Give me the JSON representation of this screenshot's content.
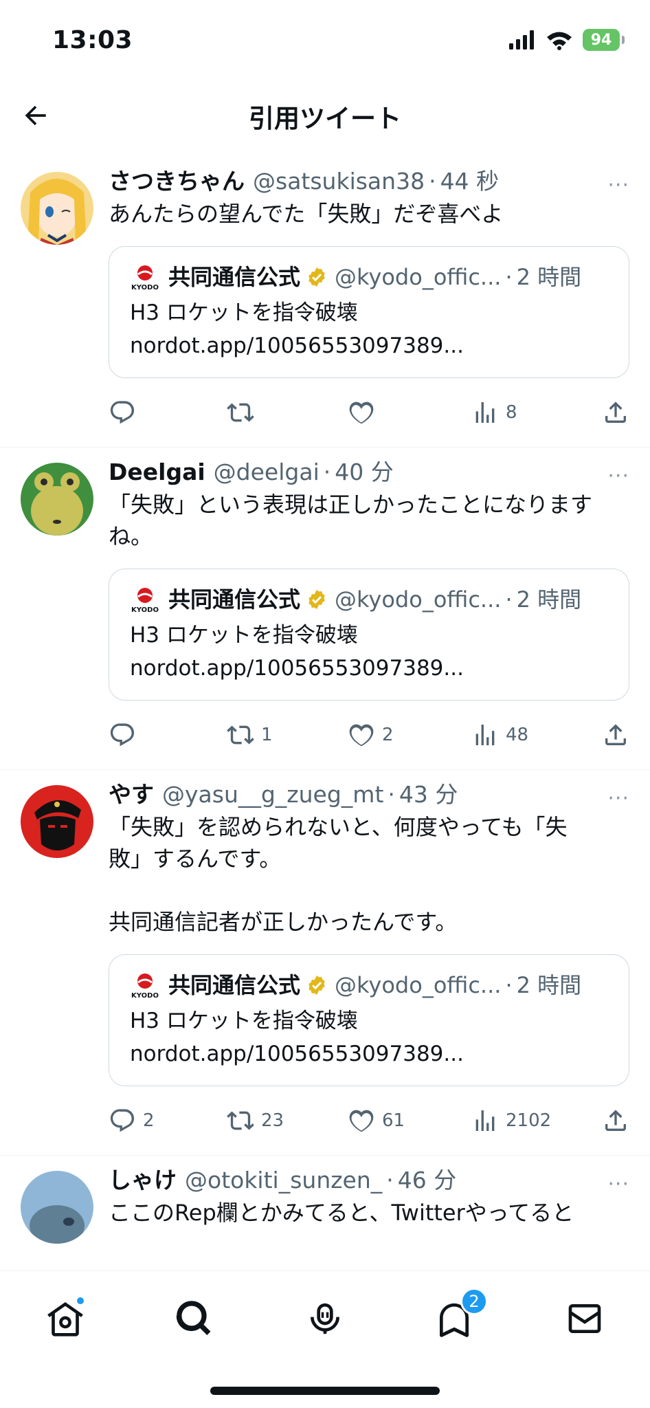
{
  "status": {
    "time": "13:03",
    "battery": "94"
  },
  "header": {
    "title": "引用ツイート"
  },
  "tweets": [
    {
      "name": "さつきちゃん",
      "handle": "@satsukisan38",
      "time": "44 秒",
      "text": "あんたらの望んでた「失敗」だぞ喜べよ",
      "quote": {
        "name": "共同通信公式",
        "handle": "@kyodo_offic...",
        "time": "2 時間",
        "line1": "H3 ロケットを指令破壊",
        "line2": "nordot.app/10056553097389..."
      },
      "stats": {
        "replies": "",
        "retweets": "",
        "likes": "",
        "views": "8"
      }
    },
    {
      "name": "Deelgai",
      "handle": "@deelgai",
      "time": "40 分",
      "text": "「失敗」という表現は正しかったことになります\nね。",
      "quote": {
        "name": "共同通信公式",
        "handle": "@kyodo_offic...",
        "time": "2 時間",
        "line1": "H3 ロケットを指令破壊",
        "line2": "nordot.app/10056553097389..."
      },
      "stats": {
        "replies": "",
        "retweets": "1",
        "likes": "2",
        "views": "48"
      }
    },
    {
      "name": "やす",
      "handle": "@yasu__g_zueg_mt",
      "time": "43 分",
      "text": "「失敗」を認められないと、何度やっても「失\n敗」するんです。\n\n共同通信記者が正しかったんです。",
      "quote": {
        "name": "共同通信公式",
        "handle": "@kyodo_offic...",
        "time": "2 時間",
        "line1": "H3 ロケットを指令破壊",
        "line2": "nordot.app/10056553097389..."
      },
      "stats": {
        "replies": "2",
        "retweets": "23",
        "likes": "61",
        "views": "2102"
      }
    },
    {
      "name": "しゃけ",
      "handle": "@otokiti_sunzen_",
      "time": "46 分",
      "text": "ここのRep欄とかみてると、Twitterやってると",
      "quote": null,
      "stats": null
    }
  ],
  "kyodo_logo_text": "KYODO",
  "more_glyph": "···",
  "dot_glyph": "·",
  "nav": {
    "notifications_badge": "2"
  },
  "colors": {
    "accent": "#1d9bf0",
    "muted": "#536471",
    "verified": "#e2b719",
    "battery": "#65c466"
  }
}
